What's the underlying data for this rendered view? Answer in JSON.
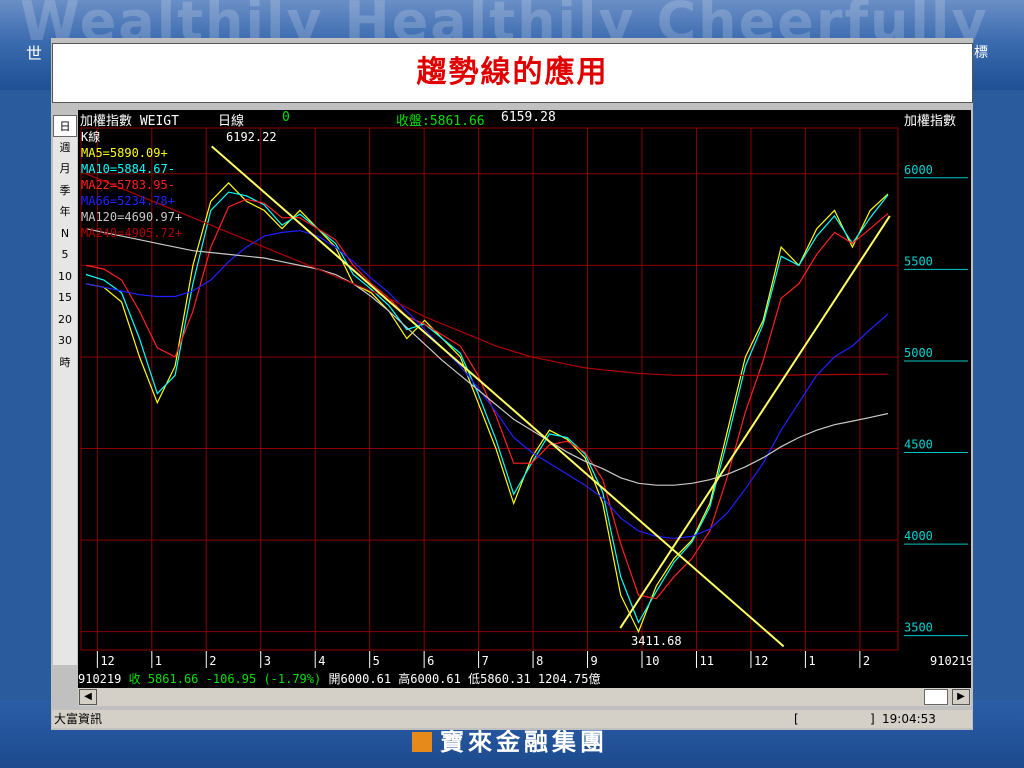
{
  "slide": {
    "watermark": "Wealthily Healthily Cheerfully",
    "left_fragment": "世",
    "right_fragment": "標",
    "footer_logo": "寶來金融集團",
    "title": "趨勢線的應用",
    "colors": {
      "title": "#e00000",
      "background": "#2a5b9c"
    }
  },
  "app": {
    "sidebar": [
      "日",
      "週",
      "月",
      "季",
      "年",
      "N",
      "5",
      "10",
      "15",
      "20",
      "30",
      "時"
    ],
    "sidebar_selected": 0,
    "header": {
      "name": "加權指數 WEIGT",
      "period": "日線",
      "zero": "0",
      "close_label": "收盤:5861.66",
      "value2": "6159.28",
      "right_title": "加權指數"
    },
    "legend": [
      {
        "label": "K線",
        "color": "#ffffff"
      },
      {
        "label": "MA5=5890.09+",
        "color": "#ffff00"
      },
      {
        "label": "MA10=5884.67-",
        "color": "#00ffff"
      },
      {
        "label": "MA22=5783.95-",
        "color": "#ff2020"
      },
      {
        "label": "MA66=5234.78+",
        "color": "#2020ff"
      },
      {
        "label": "MA120=4690.97+",
        "color": "#c8c8c8"
      },
      {
        "label": "MA240=4905.72+",
        "color": "#b00000"
      }
    ],
    "annotations": {
      "high": "6192.22",
      "low": "3411.68"
    },
    "date_code": "910219",
    "info": {
      "date": "910219",
      "close": "收 5861.66",
      "change": "-106.95 (-1.79%)",
      "open": "開6000.61",
      "high": "高6000.61",
      "low": "低5860.31",
      "volume": "1204.75億"
    },
    "status": {
      "left": "大富資訊",
      "mid": "[",
      "mid2": "]",
      "time": "19:04:53"
    }
  },
  "chart_data": {
    "type": "line",
    "ylim": [
      3400,
      6250
    ],
    "y_ticks": [
      6000,
      5500,
      5000,
      4500,
      4000,
      3500
    ],
    "x_ticks": [
      "12",
      "1",
      "2",
      "3",
      "4",
      "5",
      "6",
      "7",
      "8",
      "9",
      "10",
      "11",
      "12",
      "1",
      "2"
    ],
    "series": [
      {
        "name": "MA5",
        "color": "#ffff00",
        "values": [
          5400,
          5380,
          5300,
          5000,
          4750,
          4950,
          5500,
          5850,
          5950,
          5850,
          5800,
          5700,
          5800,
          5700,
          5600,
          5400,
          5350,
          5250,
          5100,
          5200,
          5100,
          5000,
          4750,
          4500,
          4200,
          4450,
          4600,
          4550,
          4450,
          4200,
          3700,
          3500,
          3750,
          3900,
          4000,
          4200,
          4600,
          5000,
          5200,
          5600,
          5500,
          5700,
          5800,
          5600,
          5800,
          5890
        ]
      },
      {
        "name": "MA10",
        "color": "#00ffff",
        "values": [
          5450,
          5420,
          5350,
          5100,
          4800,
          4900,
          5400,
          5800,
          5900,
          5880,
          5830,
          5720,
          5780,
          5700,
          5620,
          5450,
          5370,
          5280,
          5150,
          5180,
          5100,
          5020,
          4800,
          4550,
          4250,
          4420,
          4580,
          4560,
          4470,
          4260,
          3800,
          3550,
          3720,
          3880,
          3990,
          4180,
          4550,
          4950,
          5180,
          5550,
          5500,
          5660,
          5770,
          5620,
          5760,
          5885
        ]
      },
      {
        "name": "MA22",
        "color": "#ff2020",
        "values": [
          5500,
          5480,
          5420,
          5250,
          5050,
          5000,
          5250,
          5600,
          5820,
          5860,
          5840,
          5760,
          5760,
          5700,
          5640,
          5500,
          5400,
          5320,
          5220,
          5180,
          5120,
          5060,
          4900,
          4680,
          4420,
          4420,
          4520,
          4540,
          4480,
          4330,
          3980,
          3700,
          3680,
          3800,
          3900,
          4050,
          4350,
          4700,
          4980,
          5320,
          5400,
          5560,
          5680,
          5620,
          5700,
          5784
        ]
      },
      {
        "name": "MA66",
        "color": "#2020ff",
        "values": [
          5400,
          5380,
          5360,
          5340,
          5330,
          5330,
          5360,
          5420,
          5520,
          5600,
          5660,
          5680,
          5690,
          5660,
          5600,
          5520,
          5430,
          5350,
          5250,
          5150,
          5050,
          4950,
          4830,
          4700,
          4560,
          4480,
          4420,
          4360,
          4300,
          4230,
          4120,
          4050,
          4020,
          4010,
          4020,
          4060,
          4150,
          4280,
          4420,
          4600,
          4750,
          4900,
          5000,
          5060,
          5150,
          5235
        ]
      },
      {
        "name": "MA120",
        "color": "#c8c8c8",
        "values": [
          5700,
          5680,
          5660,
          5640,
          5620,
          5600,
          5580,
          5570,
          5560,
          5550,
          5540,
          5520,
          5500,
          5480,
          5450,
          5400,
          5330,
          5250,
          5160,
          5070,
          4980,
          4900,
          4820,
          4740,
          4660,
          4600,
          4540,
          4480,
          4430,
          4390,
          4340,
          4310,
          4300,
          4300,
          4310,
          4330,
          4360,
          4400,
          4450,
          4510,
          4560,
          4600,
          4630,
          4650,
          4670,
          4691
        ]
      },
      {
        "name": "MA240",
        "color": "#b00000",
        "values": [
          6000,
          5960,
          5920,
          5880,
          5840,
          5800,
          5760,
          5720,
          5680,
          5640,
          5600,
          5560,
          5520,
          5480,
          5440,
          5400,
          5360,
          5320,
          5270,
          5220,
          5180,
          5140,
          5100,
          5060,
          5030,
          5000,
          4980,
          4960,
          4940,
          4930,
          4920,
          4910,
          4905,
          4900,
          4900,
          4900,
          4900,
          4900,
          4900,
          4900,
          4902,
          4903,
          4904,
          4905,
          4905,
          4906
        ]
      }
    ],
    "trendlines": [
      {
        "from": [
          0.16,
          6150
        ],
        "to": [
          0.86,
          3420
        ],
        "color": "#ffff60"
      },
      {
        "from": [
          0.66,
          3520
        ],
        "to": [
          0.99,
          5770
        ],
        "color": "#ffff60"
      }
    ]
  }
}
